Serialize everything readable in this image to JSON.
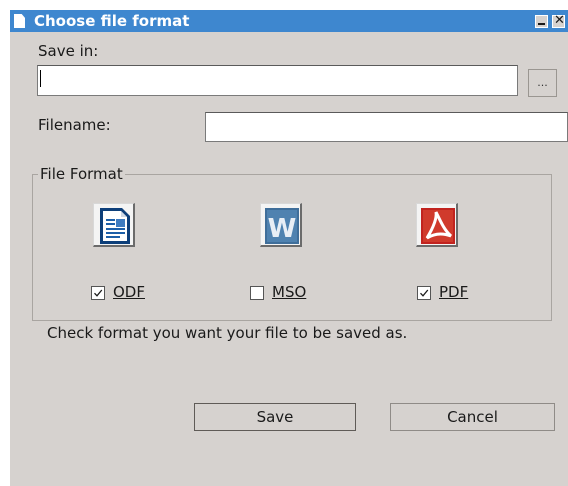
{
  "window": {
    "title": "Choose file format"
  },
  "save_in": {
    "label": "Save in:",
    "value": "",
    "browse_label": "..."
  },
  "filename": {
    "label": "Filename:",
    "value": ""
  },
  "file_format": {
    "legend": "File Format",
    "options": [
      {
        "label": "ODF",
        "checked": true,
        "icon": "odf-document-icon"
      },
      {
        "label": "MSO",
        "checked": false,
        "icon": "ms-word-icon"
      },
      {
        "label": "PDF",
        "checked": true,
        "icon": "pdf-icon"
      }
    ]
  },
  "hint": "Check format you want your file to be saved as.",
  "buttons": {
    "save": "Save",
    "cancel": "Cancel"
  },
  "colors": {
    "titlebar": "#3e87cf",
    "dialog_bg": "#d6d2cf"
  }
}
